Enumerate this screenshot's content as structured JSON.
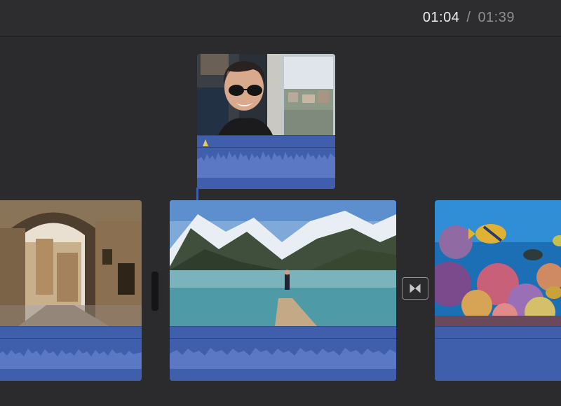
{
  "timecode": {
    "current": "01:04",
    "separator": "/",
    "total": "01:39"
  },
  "clips": [
    {
      "id": "overlay",
      "content": "woman-on-train-photo"
    },
    {
      "id": "street",
      "content": "stone-archway-street-photo"
    },
    {
      "id": "lake",
      "content": "mountain-lake-pier-photo"
    },
    {
      "id": "reef",
      "content": "coral-reef-fish-photo"
    }
  ],
  "icons": {
    "transition": "transition-icon",
    "marker": "audio-marker-icon"
  },
  "colors": {
    "background": "#2b2b2d",
    "audio_track": "#3f5fad",
    "waveform": "#5a78c4",
    "timecode_current": "#ececec",
    "timecode_total": "#8e8e93"
  }
}
